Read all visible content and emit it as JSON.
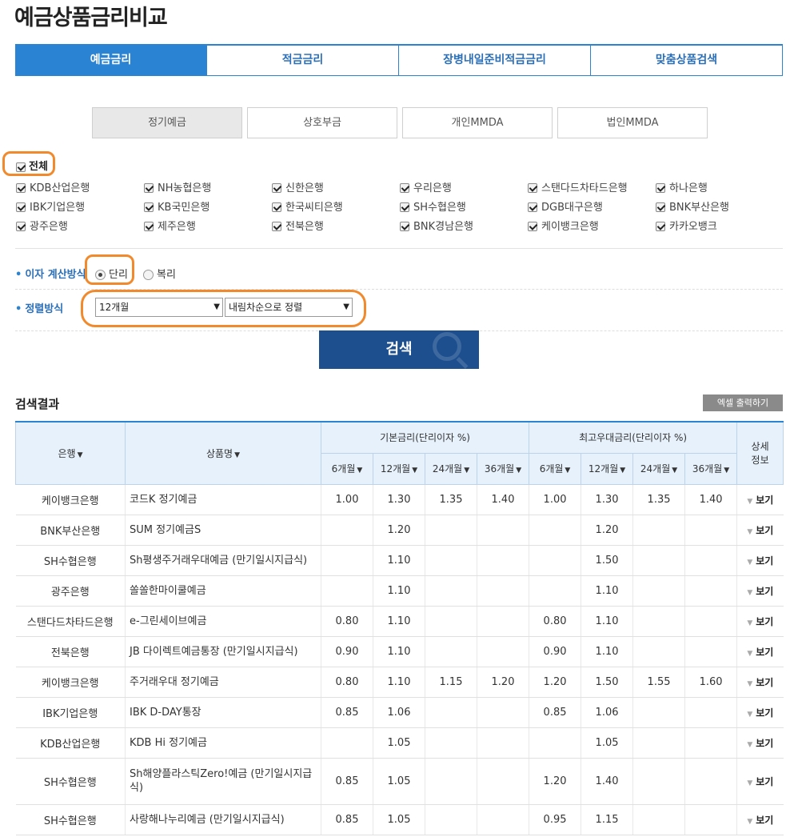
{
  "page_title": "예금상품금리비교",
  "main_tabs": [
    "예금금리",
    "적금금리",
    "장병내일준비적금금리",
    "맞춤상품검색"
  ],
  "sub_tabs": [
    "정기예금",
    "상호부금",
    "개인MMDA",
    "법인MMDA"
  ],
  "all_label": "전체",
  "banks": [
    [
      "KDB산업은행",
      "NH농협은행",
      "신한은행",
      "우리은행",
      "스탠다드차타드은행",
      "하나은행"
    ],
    [
      "IBK기업은행",
      "KB국민은행",
      "한국씨티은행",
      "SH수협은행",
      "DGB대구은행",
      "BNK부산은행"
    ],
    [
      "광주은행",
      "제주은행",
      "전북은행",
      "BNK경남은행",
      "케이뱅크은행",
      "카카오뱅크"
    ]
  ],
  "interest_label": "이자 계산방식",
  "interest_options": [
    "단리",
    "복리"
  ],
  "sort_label": "정렬방식",
  "sort_period": "12개월",
  "sort_order": "내림차순으로 정렬",
  "search_label": "검색",
  "result_title": "검색결과",
  "excel_label": "엑셀 출력하기",
  "table": {
    "col_bank": "은행",
    "col_product": "상품명",
    "col_base": "기본금리(단리이자 %)",
    "col_max": "최고우대금리(단리이자 %)",
    "col_detail_1": "상세",
    "col_detail_2": "정보",
    "periods": [
      "6개월",
      "12개월",
      "24개월",
      "36개월"
    ],
    "view_label": "보기",
    "rows": [
      {
        "bank": "케이뱅크은행",
        "product": "코드K 정기예금",
        "b6": "1.00",
        "b12": "1.30",
        "b24": "1.35",
        "b36": "1.40",
        "m6": "1.00",
        "m12": "1.30",
        "m24": "1.35",
        "m36": "1.40"
      },
      {
        "bank": "BNK부산은행",
        "product": "SUM 정기예금S",
        "b6": "",
        "b12": "1.20",
        "b24": "",
        "b36": "",
        "m6": "",
        "m12": "1.20",
        "m24": "",
        "m36": ""
      },
      {
        "bank": "SH수협은행",
        "product": "Sh평생주거래우대예금 (만기일시지급식)",
        "b6": "",
        "b12": "1.10",
        "b24": "",
        "b36": "",
        "m6": "",
        "m12": "1.50",
        "m24": "",
        "m36": ""
      },
      {
        "bank": "광주은행",
        "product": "쏠쏠한마이쿨예금",
        "b6": "",
        "b12": "1.10",
        "b24": "",
        "b36": "",
        "m6": "",
        "m12": "1.10",
        "m24": "",
        "m36": ""
      },
      {
        "bank": "스탠다드차타드은행",
        "product": "e-그린세이브예금",
        "b6": "0.80",
        "b12": "1.10",
        "b24": "",
        "b36": "",
        "m6": "0.80",
        "m12": "1.10",
        "m24": "",
        "m36": ""
      },
      {
        "bank": "전북은행",
        "product": "JB 다이렉트예금통장 (만기일시지급식)",
        "b6": "0.90",
        "b12": "1.10",
        "b24": "",
        "b36": "",
        "m6": "0.90",
        "m12": "1.10",
        "m24": "",
        "m36": ""
      },
      {
        "bank": "케이뱅크은행",
        "product": "주거래우대 정기예금",
        "b6": "0.80",
        "b12": "1.10",
        "b24": "1.15",
        "b36": "1.20",
        "m6": "1.20",
        "m12": "1.50",
        "m24": "1.55",
        "m36": "1.60"
      },
      {
        "bank": "IBK기업은행",
        "product": "IBK D-DAY통장",
        "b6": "0.85",
        "b12": "1.06",
        "b24": "",
        "b36": "",
        "m6": "0.85",
        "m12": "1.06",
        "m24": "",
        "m36": ""
      },
      {
        "bank": "KDB산업은행",
        "product": "KDB Hi 정기예금",
        "b6": "",
        "b12": "1.05",
        "b24": "",
        "b36": "",
        "m6": "",
        "m12": "1.05",
        "m24": "",
        "m36": ""
      },
      {
        "bank": "SH수협은행",
        "product": "Sh해양플라스틱Zero!예금 (만기일시지급식)",
        "b6": "0.85",
        "b12": "1.05",
        "b24": "",
        "b36": "",
        "m6": "1.20",
        "m12": "1.40",
        "m24": "",
        "m36": ""
      },
      {
        "bank": "SH수협은행",
        "product": "사랑해나누리예금 (만기일시지급식)",
        "b6": "0.85",
        "b12": "1.05",
        "b24": "",
        "b36": "",
        "m6": "0.95",
        "m12": "1.15",
        "m24": "",
        "m36": ""
      }
    ]
  }
}
